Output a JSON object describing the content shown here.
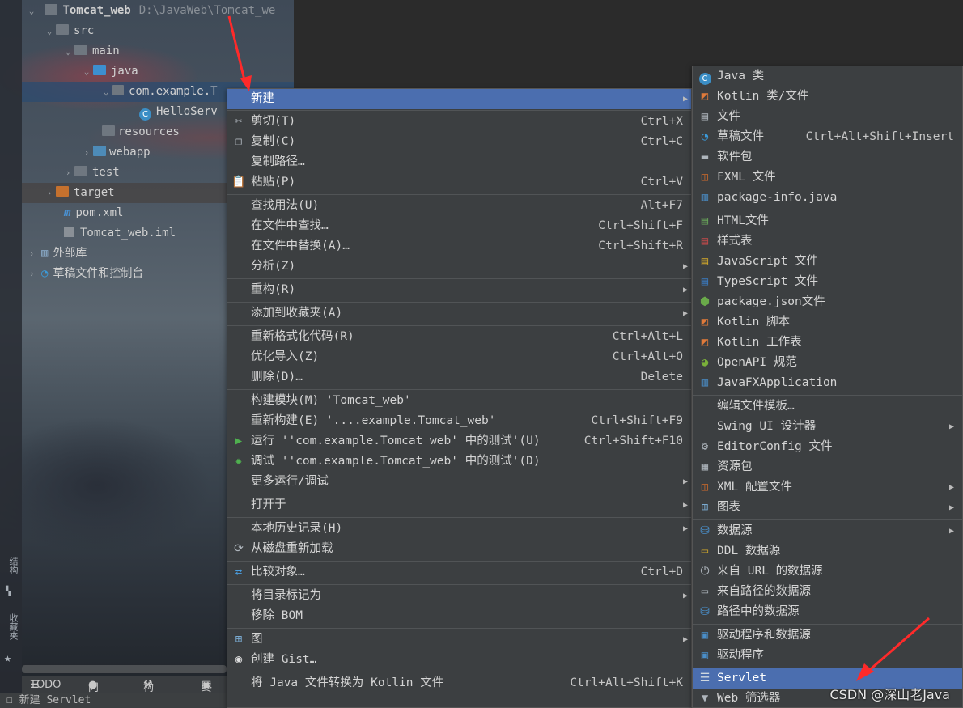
{
  "project_tree": {
    "root": {
      "name": "Tomcat_web",
      "path": "D:\\JavaWeb\\Tomcat_we"
    },
    "items": [
      {
        "label": "src"
      },
      {
        "label": "main"
      },
      {
        "label": "java"
      },
      {
        "label": "com.example.T"
      },
      {
        "label": "HelloServ"
      },
      {
        "label": "resources"
      },
      {
        "label": "webapp"
      },
      {
        "label": "test"
      },
      {
        "label": "target"
      },
      {
        "label": "pom.xml"
      },
      {
        "label": "Tomcat_web.iml"
      },
      {
        "label": "外部库"
      },
      {
        "label": "草稿文件和控制台"
      }
    ]
  },
  "left_strip": {
    "structure": "结构",
    "favorites": "收藏夹"
  },
  "bottom_tabs": {
    "todo": "TODO",
    "problems": "问题",
    "build": "构建",
    "terminal": "终"
  },
  "status_bar": {
    "text": "新建 Servlet"
  },
  "main_menu": {
    "items": [
      {
        "label": "新建",
        "shortcut": ""
      },
      {
        "label": "剪切(T)",
        "shortcut": "Ctrl+X"
      },
      {
        "label": "复制(C)",
        "shortcut": "Ctrl+C"
      },
      {
        "label": "复制路径…",
        "shortcut": ""
      },
      {
        "label": "粘贴(P)",
        "shortcut": "Ctrl+V"
      },
      {
        "label": "查找用法(U)",
        "shortcut": "Alt+F7"
      },
      {
        "label": "在文件中查找…",
        "shortcut": "Ctrl+Shift+F"
      },
      {
        "label": "在文件中替换(A)…",
        "shortcut": "Ctrl+Shift+R"
      },
      {
        "label": "分析(Z)",
        "shortcut": ""
      },
      {
        "label": "重构(R)",
        "shortcut": ""
      },
      {
        "label": "添加到收藏夹(A)",
        "shortcut": ""
      },
      {
        "label": "重新格式化代码(R)",
        "shortcut": "Ctrl+Alt+L"
      },
      {
        "label": "优化导入(Z)",
        "shortcut": "Ctrl+Alt+O"
      },
      {
        "label": "删除(D)…",
        "shortcut": "Delete"
      },
      {
        "label": "构建模块(M) 'Tomcat_web'",
        "shortcut": ""
      },
      {
        "label": "重新构建(E) '....example.Tomcat_web'",
        "shortcut": "Ctrl+Shift+F9"
      },
      {
        "label": "运行 ''com.example.Tomcat_web' 中的测试'(U)",
        "shortcut": "Ctrl+Shift+F10"
      },
      {
        "label": "调试 ''com.example.Tomcat_web' 中的测试'(D)",
        "shortcut": ""
      },
      {
        "label": "更多运行/调试",
        "shortcut": ""
      },
      {
        "label": "打开于",
        "shortcut": ""
      },
      {
        "label": "本地历史记录(H)",
        "shortcut": ""
      },
      {
        "label": "从磁盘重新加载",
        "shortcut": ""
      },
      {
        "label": "比较对象…",
        "shortcut": "Ctrl+D"
      },
      {
        "label": "将目录标记为",
        "shortcut": ""
      },
      {
        "label": "移除 BOM",
        "shortcut": ""
      },
      {
        "label": "图",
        "shortcut": ""
      },
      {
        "label": "创建 Gist…",
        "shortcut": ""
      },
      {
        "label": "将 Java 文件转换为 Kotlin 文件",
        "shortcut": "Ctrl+Alt+Shift+K"
      }
    ]
  },
  "sub_menu": {
    "items": [
      {
        "label": "Java 类",
        "shortcut": ""
      },
      {
        "label": "Kotlin 类/文件",
        "shortcut": ""
      },
      {
        "label": "文件",
        "shortcut": ""
      },
      {
        "label": "草稿文件",
        "shortcut": "Ctrl+Alt+Shift+Insert"
      },
      {
        "label": "软件包",
        "shortcut": ""
      },
      {
        "label": "FXML 文件",
        "shortcut": ""
      },
      {
        "label": "package-info.java",
        "shortcut": ""
      },
      {
        "label": "HTML文件",
        "shortcut": ""
      },
      {
        "label": "样式表",
        "shortcut": ""
      },
      {
        "label": "JavaScript 文件",
        "shortcut": ""
      },
      {
        "label": "TypeScript 文件",
        "shortcut": ""
      },
      {
        "label": "package.json文件",
        "shortcut": ""
      },
      {
        "label": "Kotlin 脚本",
        "shortcut": ""
      },
      {
        "label": "Kotlin 工作表",
        "shortcut": ""
      },
      {
        "label": "OpenAPI 规范",
        "shortcut": ""
      },
      {
        "label": "JavaFXApplication",
        "shortcut": ""
      },
      {
        "label": "编辑文件模板…",
        "shortcut": ""
      },
      {
        "label": "Swing UI 设计器",
        "shortcut": ""
      },
      {
        "label": "EditorConfig 文件",
        "shortcut": ""
      },
      {
        "label": "资源包",
        "shortcut": ""
      },
      {
        "label": "XML 配置文件",
        "shortcut": ""
      },
      {
        "label": "图表",
        "shortcut": ""
      },
      {
        "label": "数据源",
        "shortcut": ""
      },
      {
        "label": "DDL 数据源",
        "shortcut": ""
      },
      {
        "label": "来自 URL 的数据源",
        "shortcut": ""
      },
      {
        "label": "来自路径的数据源",
        "shortcut": ""
      },
      {
        "label": "路径中的数据源",
        "shortcut": ""
      },
      {
        "label": "驱动程序和数据源",
        "shortcut": ""
      },
      {
        "label": "驱动程序",
        "shortcut": ""
      },
      {
        "label": "Servlet",
        "shortcut": ""
      },
      {
        "label": "Web 筛选器",
        "shortcut": ""
      }
    ]
  },
  "watermark": "CSDN @深山老Java",
  "colors": {
    "menu_bg": "#3c3f41",
    "highlight": "#4b6eaf",
    "arrow": "#ff2a2a"
  }
}
